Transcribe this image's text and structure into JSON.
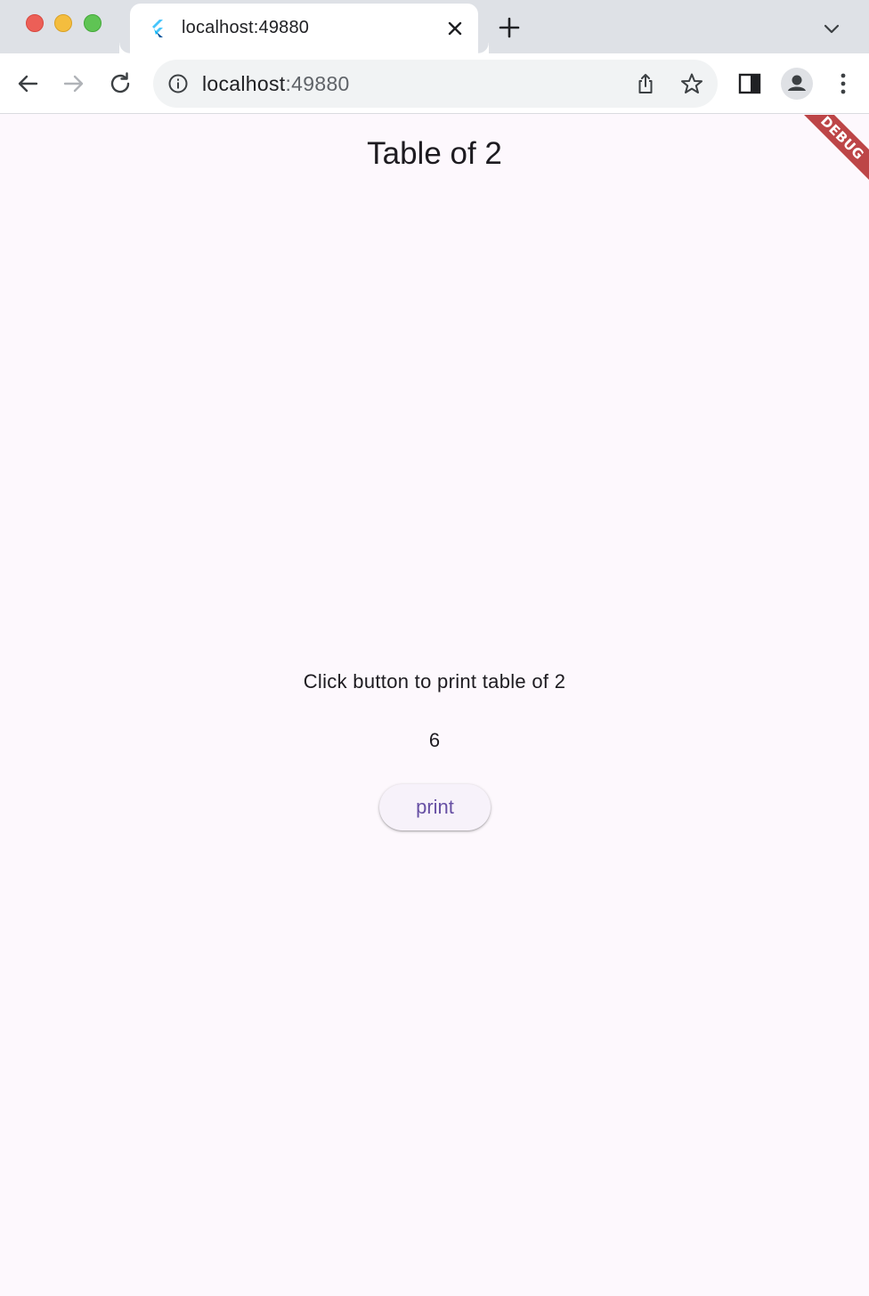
{
  "browser": {
    "tab": {
      "title": "localhost:49880"
    },
    "address": {
      "host": "localhost",
      "port": ":49880"
    }
  },
  "app": {
    "title": "Table of 2",
    "prompt": "Click button to print table of 2",
    "result": "6",
    "button_label": "print",
    "debug_banner": "DEBUG"
  },
  "colors": {
    "accent": "#6750a4",
    "background": "#fdf8fd",
    "debug": "#a40000"
  }
}
